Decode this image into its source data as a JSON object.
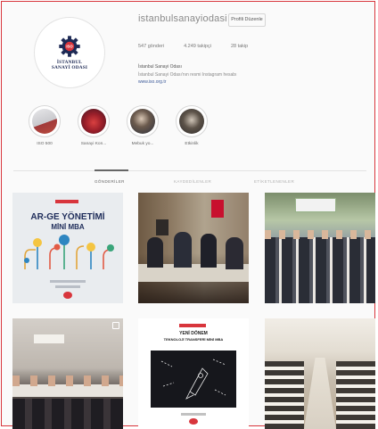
{
  "profile": {
    "username": "istanbulsanayiodasi",
    "edit_button": "Profili Düzenle",
    "stats": [
      "547 gönderi",
      "4.249 takipçi",
      "28 takip"
    ],
    "bio_name": "İstanbul Sanayi Odası",
    "bio_text": "İstanbul Sanayi Odası'nın resmi Instagram hesabı",
    "bio_link": "www.iso.org.tr",
    "logo_text_line1": "İSTANBUL",
    "logo_text_line2": "SANAYİ ODASI",
    "logo_mark": "ISO"
  },
  "highlights": [
    {
      "label": "ISO 500"
    },
    {
      "label": "Sanayi Kon..."
    },
    {
      "label": "Mebuk yo..."
    },
    {
      "label": "Etkinlik"
    }
  ],
  "tabs": [
    {
      "label": "GÖNDERİLER",
      "active": true
    },
    {
      "label": "KAYDEDİLENLER",
      "active": false
    },
    {
      "label": "ETİKETLENENLER",
      "active": false
    }
  ],
  "posts": [
    {
      "title": "AR-GE YÖNETİMİ",
      "subtitle": "MİNİ MBA"
    },
    {},
    {},
    {},
    {
      "title": "YENİ DÖNEM",
      "subtitle": "TEKNOLOJİ TRANSFERİ MİNİ MBA"
    },
    {}
  ],
  "colors": {
    "accent": "#d8353c",
    "brand": "#1e2a55"
  }
}
